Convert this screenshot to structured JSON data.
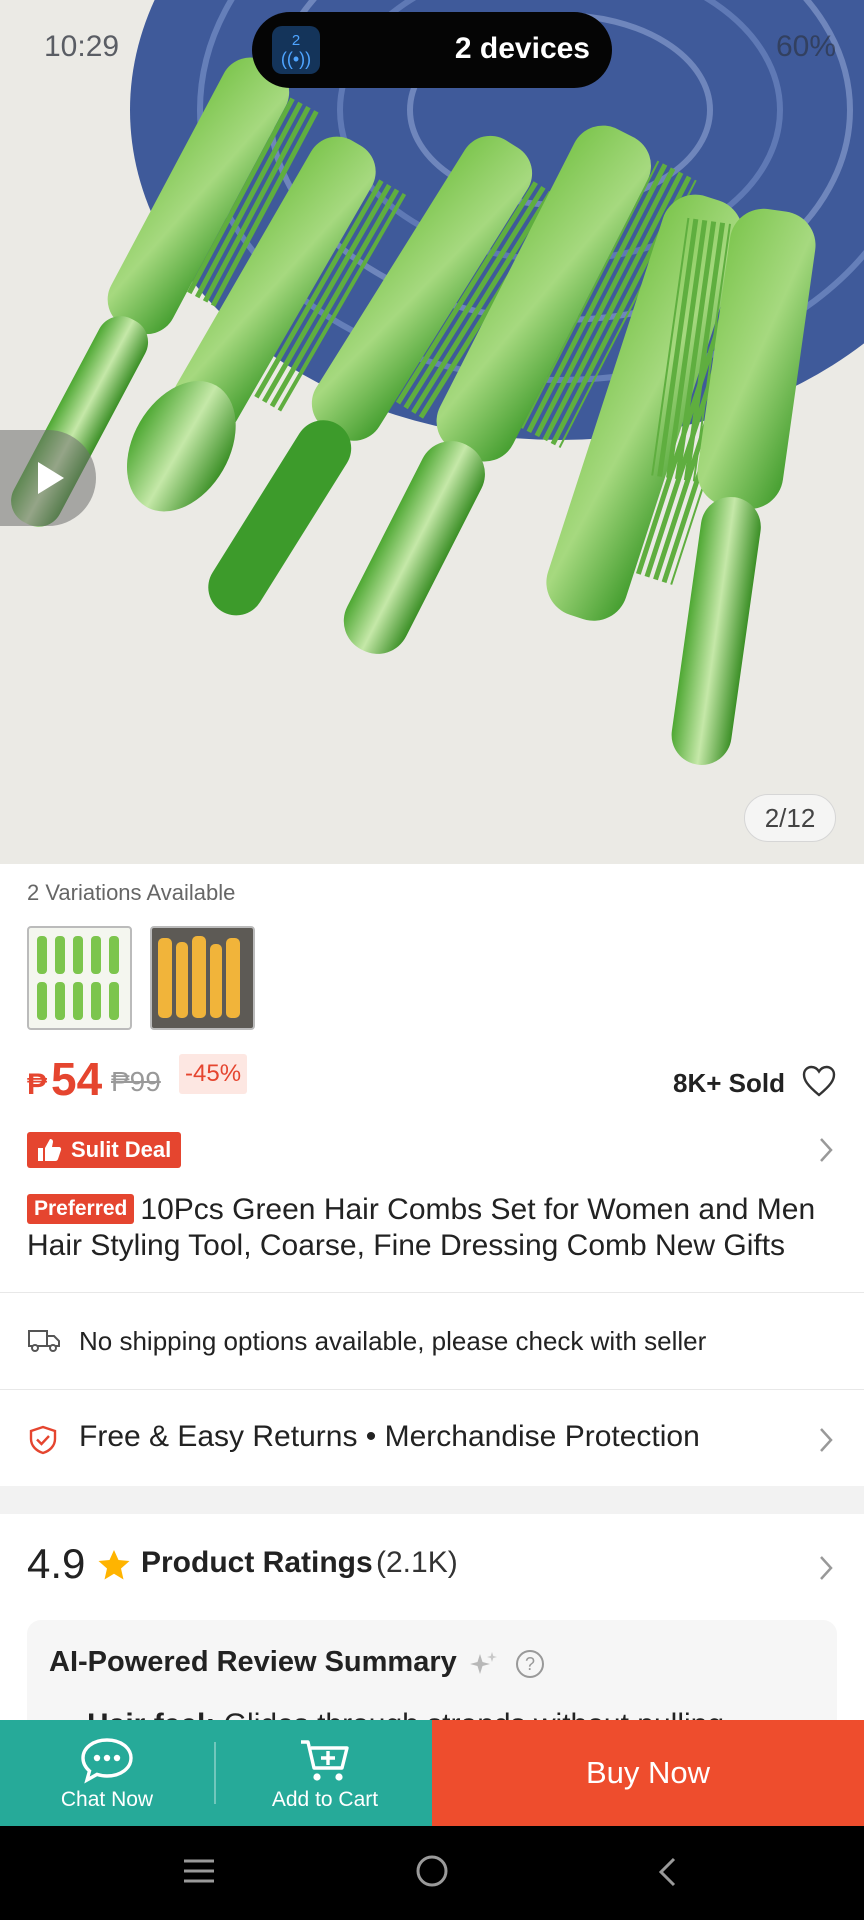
{
  "status_bar": {
    "time": "10:29",
    "right_text": "60%",
    "devices_count": "2",
    "devices_label": "2 devices"
  },
  "gallery": {
    "counter": "2/12"
  },
  "variations": {
    "label": "2 Variations Available",
    "options": [
      {
        "name": "green-combs-variation"
      },
      {
        "name": "yellow-combs-variation"
      }
    ]
  },
  "pricing": {
    "currency": "₱",
    "current": "54",
    "original": "₱99",
    "discount": "-45%",
    "sold": "8K+ Sold"
  },
  "deal": {
    "badge": "Sulit Deal"
  },
  "product": {
    "badge": "Preferred",
    "title": "10Pcs Green Hair Combs Set for Women and Men Hair Styling Tool, Coarse, Fine Dressing Comb New Gifts"
  },
  "shipping": {
    "text": "No shipping options available, please check with seller"
  },
  "returns": {
    "text": "Free & Easy Returns  •  Merchandise Protection"
  },
  "ratings": {
    "score": "4.9",
    "label": "Product Ratings",
    "count": "(2.1K)"
  },
  "ai_summary": {
    "title": "AI-Powered Review Summary",
    "help": "?",
    "snippet_bold": "Hair feel:",
    "snippet_text": " Glides through strands without pulling"
  },
  "action_bar": {
    "chat_label": "Chat Now",
    "cart_label": "Add to Cart",
    "buy_label": "Buy Now"
  },
  "colors": {
    "brand_orange": "#ee4d2d",
    "price_red": "#e5452f",
    "teal": "#26aa99"
  }
}
